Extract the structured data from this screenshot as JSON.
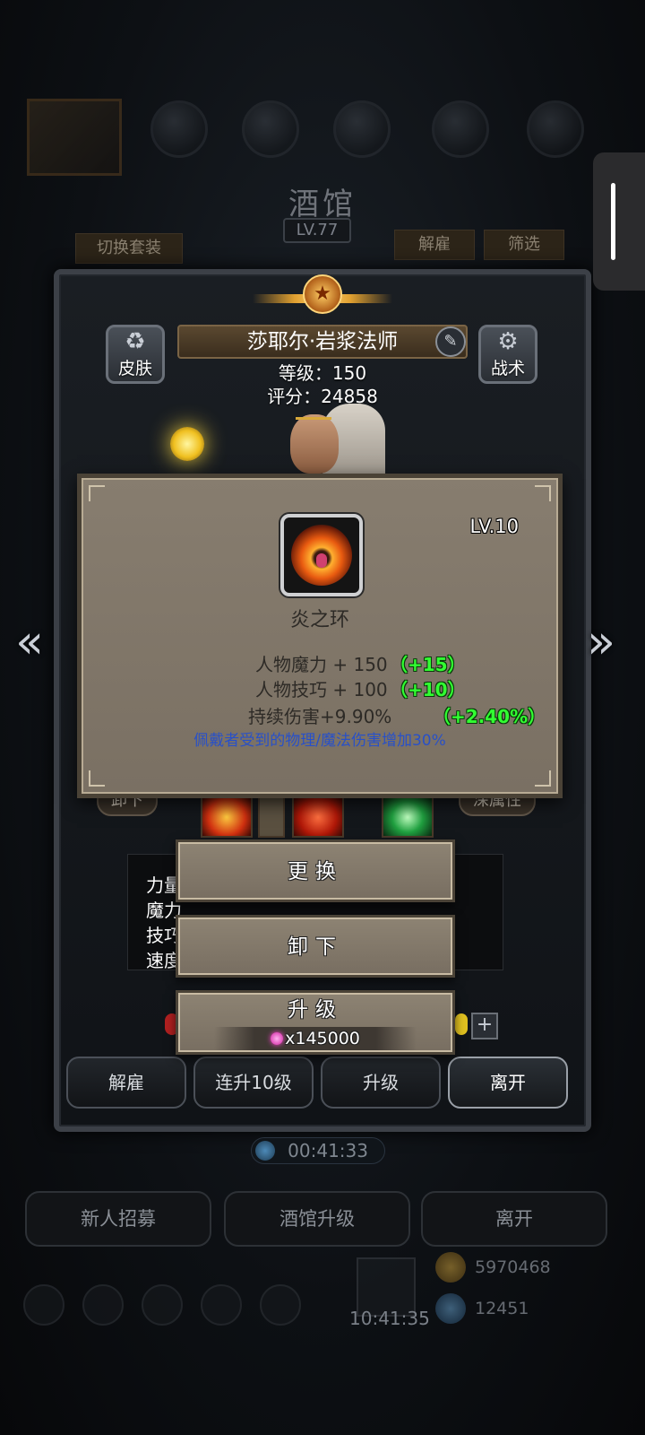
{
  "background": {
    "title": "酒馆",
    "level": "LV.77",
    "switch_outfit": "切换套装",
    "dismiss_tab": "解雇",
    "filter_tab": "筛选",
    "timer": "00:41:33",
    "buttons": [
      "新人招募",
      "酒馆升级",
      "离开"
    ],
    "gold": "5970468",
    "gems": "12451",
    "clock": "10:41:35"
  },
  "hero": {
    "name": "莎耶尔·岩浆法师",
    "level_line": "等级：150",
    "score_line": "评分：24858",
    "skin_label": "皮肤",
    "tactics_label": "战术",
    "unequip_tag": "卸下",
    "elemental_tag": "深属性",
    "attr_labels": [
      "力量",
      "魔力",
      "技巧",
      "速度"
    ],
    "actions": [
      "解雇",
      "连升10级",
      "升级",
      "离开"
    ]
  },
  "item": {
    "level": "LV.10",
    "name": "炎之环",
    "stats": [
      {
        "text": "人物魔力 + 150",
        "bonus": "（+15）"
      },
      {
        "text": "人物技巧 + 100",
        "bonus": "（+10）"
      },
      {
        "text": "持续伤害+9.90%",
        "bonus": "（+2.40%）"
      }
    ],
    "effect": "佩戴者受到的物理/魔法伤害增加30%"
  },
  "popup": {
    "replace": "更换",
    "unequip": "卸下",
    "upgrade": "升级",
    "cost": "x145000"
  },
  "colors": {
    "bonus_green": "#32ff32",
    "effect_blue": "#2850c8",
    "card_bg": "#877d6f"
  }
}
